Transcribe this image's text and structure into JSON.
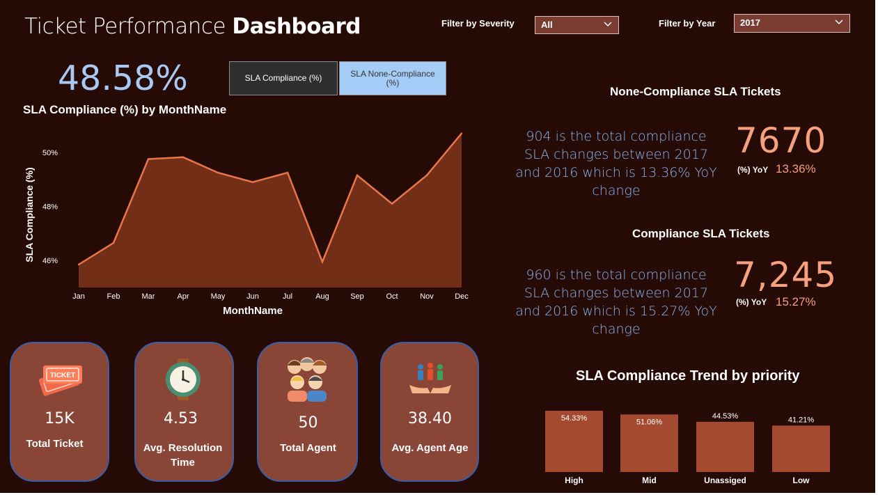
{
  "header": {
    "title_light": "Ticket Performance ",
    "title_bold": "Dashboard",
    "severity_filter_label": "Filter by Severity",
    "severity_filter_value": "All",
    "year_filter_label": "Filter by Year",
    "year_filter_value": "2017"
  },
  "kpi": {
    "sla_compliance": "48.58%"
  },
  "toggle": {
    "compliance_label": "SLA Compliance (%)",
    "noncompliance_label": "SLA None-Compliance (%)"
  },
  "chart_data": [
    {
      "type": "area",
      "title": "SLA Compliance (%) by MonthName",
      "xlabel": "MonthName",
      "ylabel": "SLA Compliance (%)",
      "categories": [
        "Jan",
        "Feb",
        "Mar",
        "Apr",
        "May",
        "Jun",
        "Jul",
        "Aug",
        "Sep",
        "Oct",
        "Nov",
        "Dec"
      ],
      "values": [
        45.85,
        46.65,
        49.75,
        49.82,
        49.25,
        48.9,
        49.25,
        45.95,
        49.15,
        48.1,
        49.15,
        50.7
      ],
      "yticks": [
        "46%",
        "48%",
        "50%"
      ],
      "ylim": [
        45,
        51
      ],
      "color": "#e8764a",
      "fill": "#732e18"
    },
    {
      "type": "bar",
      "title": "SLA Compliance Trend by priority",
      "categories": [
        "High",
        "Mid",
        "Unassiged",
        "Low"
      ],
      "values": [
        54.33,
        51.06,
        44.53,
        41.21
      ],
      "labels": [
        "54.33%",
        "51.06%",
        "44.53%",
        "41.21%"
      ],
      "color": "#a34a30"
    }
  ],
  "cards": [
    {
      "value": "15K",
      "label": "Total Ticket",
      "icon": "ticket-icon"
    },
    {
      "value": "4.53",
      "label": "Avg. Resolution Time",
      "icon": "stopwatch-icon"
    },
    {
      "value": "50",
      "label": "Total Agent",
      "icon": "people-group-icon"
    },
    {
      "value": "38.40",
      "label": "Avg. Agent Age",
      "icon": "people-hands-icon"
    }
  ],
  "noncompliance": {
    "title": "None-Compliance SLA Tickets",
    "description": "904 is the total compliance SLA changes between 2017 and 2016 which is 13.36% YoY change",
    "value": "7670",
    "yoy_label": "(%) YoY",
    "yoy_value": "13.36%"
  },
  "compliance": {
    "title": "Compliance SLA Tickets",
    "description": "960 is the total compliance SLA changes between 2017 and 2016 which is 15.27% YoY change",
    "value": "7,245",
    "yoy_label": "(%) YoY",
    "yoy_value": "15.27%"
  },
  "colors": {
    "background": "#260a05",
    "card": "#894536",
    "accent_orange": "#f6a07f",
    "accent_blue": "#a9c9f3"
  }
}
